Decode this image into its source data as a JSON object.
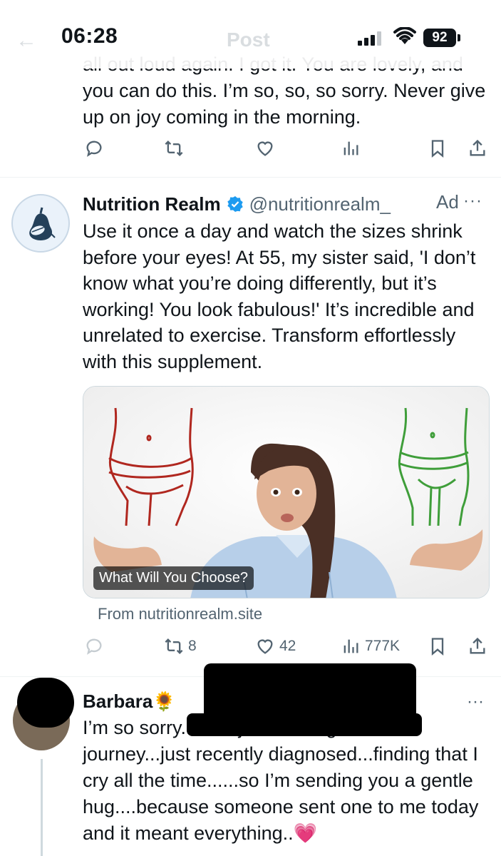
{
  "status_bar": {
    "time": "06:28",
    "battery": "92",
    "back_glyph": "←",
    "ghost_title": "Post"
  },
  "previous_tweet": {
    "text_partial": "all out loud again. I got it. You are lovely, and",
    "text": "you can do this. I’m so, so, so sorry. Never give up on joy coming in the morning.",
    "actions": [
      "reply-icon",
      "retweet-icon",
      "like-icon",
      "views-icon",
      "bookmark-icon",
      "share-icon"
    ]
  },
  "ad_tweet": {
    "name": "Nutrition Realm",
    "handle": "@nutritionrealm_",
    "ad_label": "Ad",
    "more": "···",
    "verified_color": "#1d9bf0",
    "body": "Use it once a day and watch the sizes shrink before your eyes! At 55, my sister said, 'I don’t know what you’re doing differently, but it’s working! You look fabulous!' It’s incredible and unrelated to exercise. Transform effortlessly with this supplement.",
    "card": {
      "caption": "What Will You Choose?",
      "from": "From nutritionrealm.site",
      "left_figure_color": "#b0271f",
      "right_figure_color": "#3f9e3a"
    },
    "stats": {
      "retweets": "8",
      "likes": "42",
      "views": "777K"
    }
  },
  "reply": {
    "name": "Barbara🌻",
    "more": "···",
    "line1_visible": "I’m so sorry.... I’m just starting on this",
    "text": "journey...just recently diagnosed...finding that I  cry all the time......so I’m sending you a gentle hug....because someone sent one to me today and it meant everything..",
    "emoji": "💗"
  },
  "colors": {
    "text": "#0f1419",
    "secondary": "#536471",
    "divider": "#eff3f4",
    "accent": "#1d9bf0"
  }
}
